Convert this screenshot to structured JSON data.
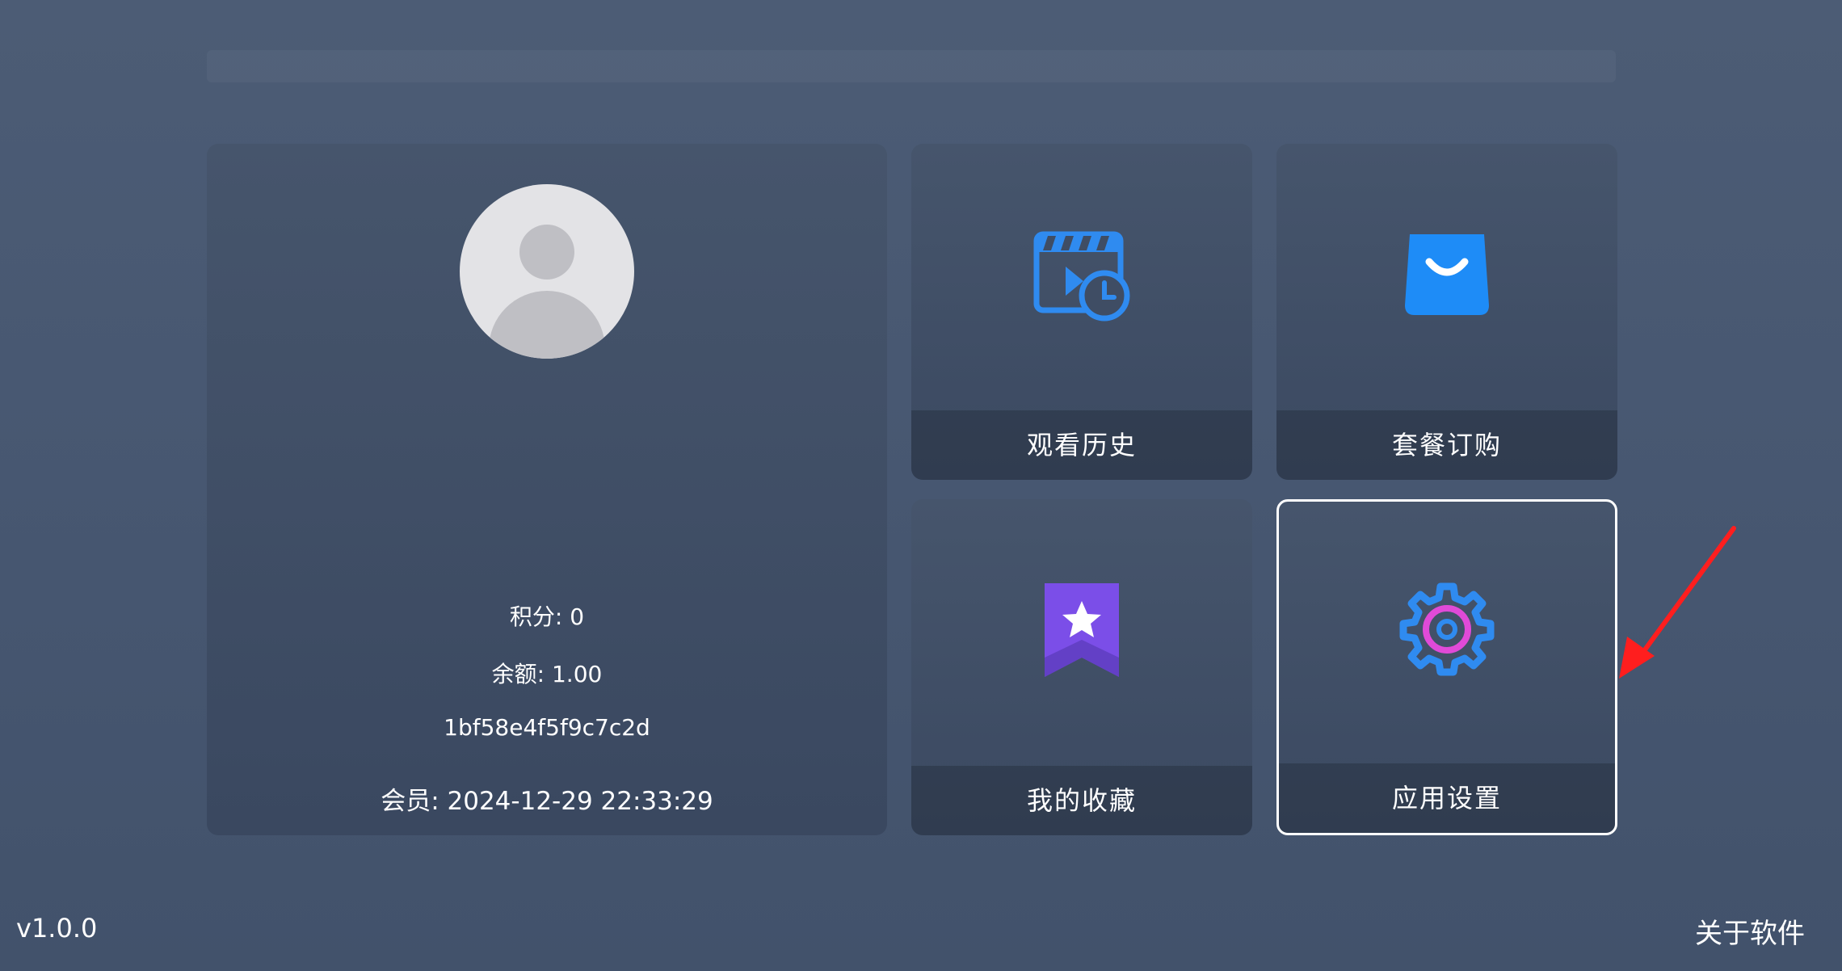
{
  "profile": {
    "points": "积分: 0",
    "balance": "余额: 1.00",
    "device_id": "1bf58e4f5f9c7c2d",
    "membership": "会员: 2024-12-29 22:33:29"
  },
  "tiles": [
    {
      "label": "观看历史",
      "icon": "history-clapper-icon",
      "color": "#2f8bf0"
    },
    {
      "label": "套餐订购",
      "icon": "shopping-bag-icon",
      "color": "#1e8cf7"
    },
    {
      "label": "我的收藏",
      "icon": "bookmark-star-icon",
      "color": "#7b4ee8"
    },
    {
      "label": "应用设置",
      "icon": "settings-gear-icon",
      "color": "#2f8bf0",
      "selected": true
    }
  ],
  "footer": {
    "version": "v1.0.0",
    "about": "关于软件"
  },
  "colors": {
    "background": "#4a5a72",
    "card": "#3f4d64",
    "accent_blue": "#2f8bf0",
    "accent_purple": "#7b4ee8",
    "accent_pink": "#e04ad8",
    "annotation_arrow": "#ff1e1e"
  }
}
